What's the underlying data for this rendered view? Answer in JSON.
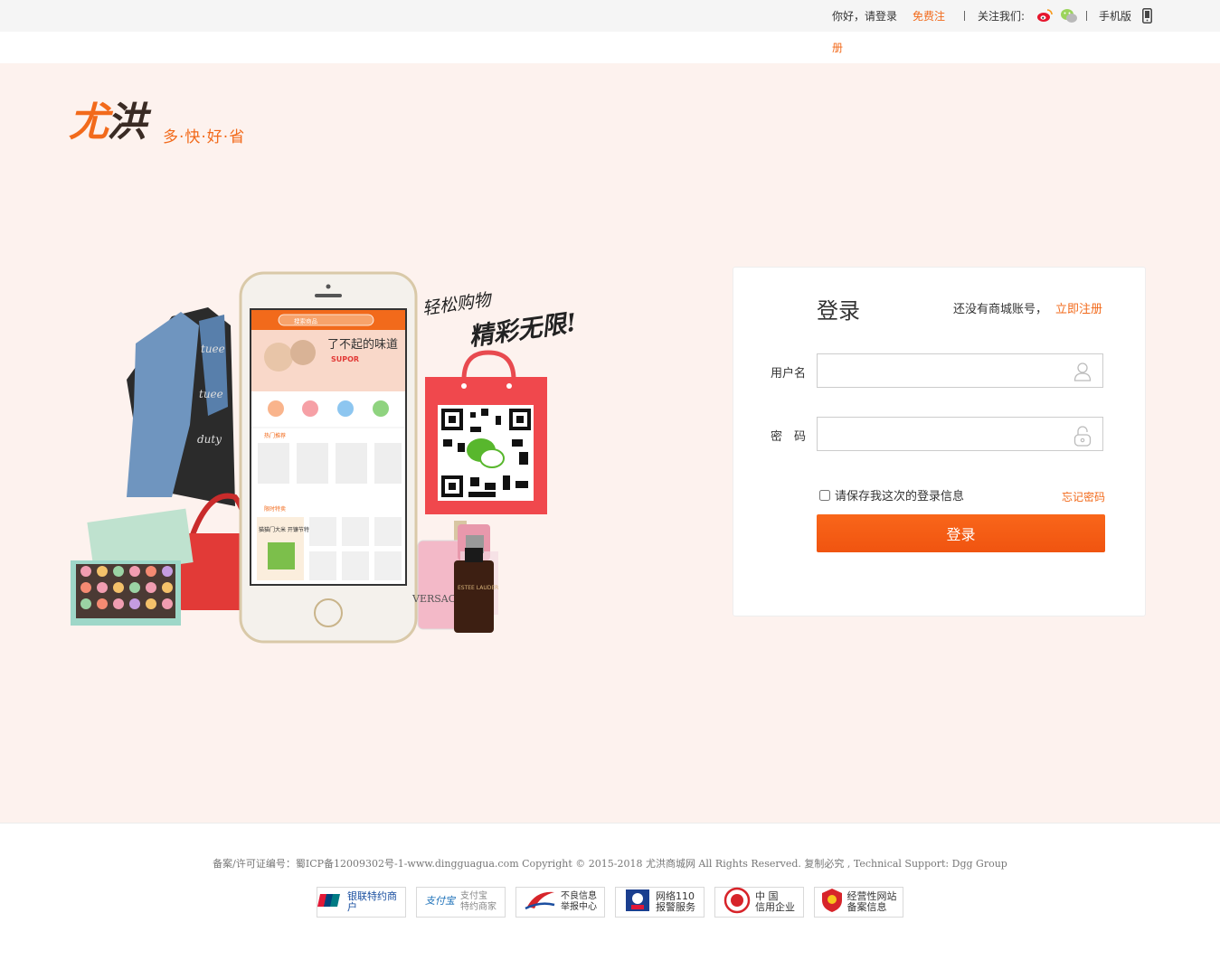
{
  "topbar": {
    "greeting": "你好，请登录",
    "register_line1": "免费注",
    "register_line2": "册",
    "follow_label": "关注我们:",
    "weibo_icon": "weibo-icon",
    "wechat_icon": "wechat-icon",
    "mobile_label": "手机版",
    "phone_icon": "phone-icon"
  },
  "logo": {
    "char1": "尤",
    "char2": "洪",
    "slogan": "多·快·好·省"
  },
  "promo": {
    "headline1": "轻松购物",
    "headline2": "精彩无限!",
    "screen_search": "搜索商品",
    "screen_banner": "了不起的味道",
    "screen_brand": "SUPOR",
    "screen_section1": "热门推荐",
    "screen_section2": "限时特卖",
    "screen_promo": "猫猫门大米 开镰节特惠专场",
    "perfume_brand": "VERSACE",
    "serum_brand": "ESTEE LAUDER"
  },
  "login": {
    "title": "登录",
    "no_account": "还没有商城账号，",
    "register_link": "立即注册",
    "username_label": "用户名",
    "username_value": "",
    "password_label": "密　码",
    "password_value": "",
    "remember_label": "请保存我这次的登录信息",
    "remember_checked": false,
    "forgot_link": "忘记密码",
    "submit_label": "登录"
  },
  "footer": {
    "copyright": "备案/许可证编号：蜀ICP备12009302号-1-www.dingguagua.com Copyright © 2015-2018 尤洪商城网 All Rights Reserved. 复制必究 , Technical Support: Dgg Group",
    "badges": [
      {
        "icon": "unionpay-icon",
        "line1": "银联特约商户",
        "line2": ""
      },
      {
        "icon": "alipay-icon",
        "line1": "支付宝",
        "line2": "特约商家"
      },
      {
        "icon": "report-center-icon",
        "line1": "不良信息",
        "line2": "举报中心"
      },
      {
        "icon": "police-110-icon",
        "line1": "网络110",
        "line2": "报警服务"
      },
      {
        "icon": "trust-seal-icon",
        "line1": "中 国",
        "line2": "信用企业"
      },
      {
        "icon": "business-website-icon",
        "line1": "经营性网站",
        "line2": "备案信息"
      }
    ]
  },
  "colors": {
    "accent": "#f26a1b",
    "page_bg": "#fdf2ee"
  }
}
